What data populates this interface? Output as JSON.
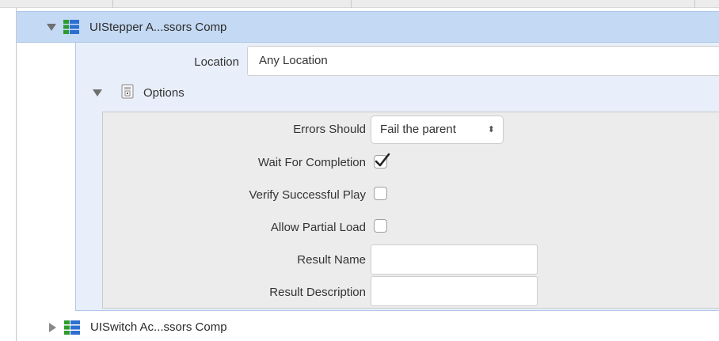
{
  "steps": [
    {
      "title": "UIStepper A...ssors Comp",
      "expanded": true,
      "selected": true
    },
    {
      "title": "UISwitch Ac...ssors Comp",
      "expanded": false,
      "selected": false
    }
  ],
  "location": {
    "label": "Location",
    "value": "Any Location"
  },
  "options": {
    "label": "Options",
    "errors": {
      "label": "Errors Should",
      "value": "Fail the parent",
      "arrows": "⬍"
    },
    "wait_for_completion": {
      "label": "Wait For Completion",
      "checked": true
    },
    "verify_successful_play": {
      "label": "Verify Successful Play",
      "checked": false
    },
    "allow_partial_load": {
      "label": "Allow Partial Load",
      "checked": false
    },
    "result_name": {
      "label": "Result Name",
      "value": ""
    },
    "result_description": {
      "label": "Result Description",
      "value": ""
    }
  },
  "colors": {
    "selection": "#c4d9f3",
    "details_background": "#e8effa",
    "options_background": "#ececec"
  },
  "icons": {
    "step": "green-blue-stack-icon",
    "options": "document-options-icon"
  }
}
